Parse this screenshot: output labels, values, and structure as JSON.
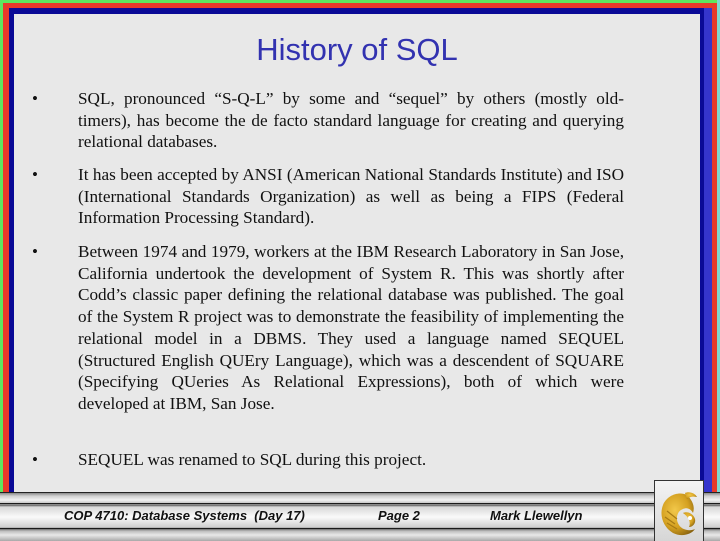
{
  "slide": {
    "title": "History of SQL",
    "bullet_glyph": "•",
    "bullets": [
      {
        "text": "SQL, pronounced “S-Q-L” by some and “sequel” by others (mostly old-timers), has become the de facto standard language for creating and querying relational databases."
      },
      {
        "text": "It has been accepted by ANSI (American National Standards Institute) and ISO (International Standards Organization) as well as being a FIPS (Federal Information Processing Standard)."
      },
      {
        "text": "Between 1974 and 1979, workers at the IBM Research Laboratory in San Jose, California undertook the development of System R.  This was shortly after Codd’s classic paper defining the relational database was published.  The goal of the System R project was to demonstrate the feasibility of implementing the relational model in a DBMS.  They used a language named SEQUEL (Structured English QUEry Language), which was a descendent of SQUARE (Specifying QUeries As Relational Expressions), both of which were developed at IBM, San Jose."
      },
      {
        "text": "SEQUEL was renamed to SQL during this project."
      }
    ]
  },
  "footer": {
    "course": "COP 4710: Database Systems  (Day 17)",
    "page": "Page 2",
    "author": "Mark Llewellyn",
    "logo_icon": "ucf-pegasus-logo-icon"
  },
  "colors": {
    "background": "#e8e8e8",
    "title": "#3232b0",
    "frame_green": "#5ee65e",
    "frame_red": "#e8392a",
    "frame_navy": "#0a0a96",
    "frame_blue": "#3535cc",
    "logo_gold": "#d4a020"
  }
}
